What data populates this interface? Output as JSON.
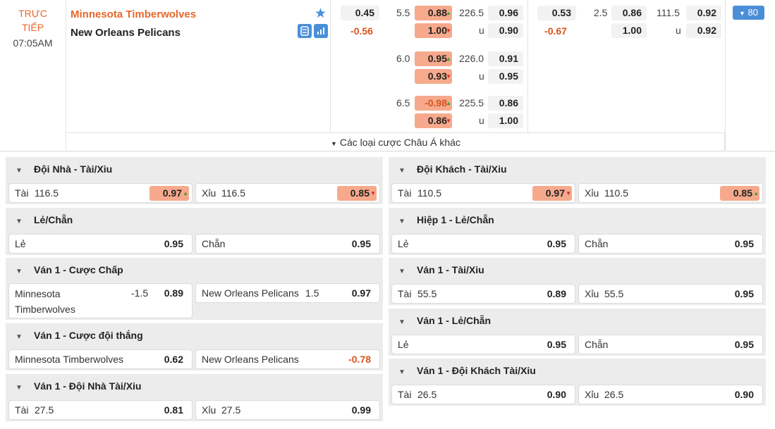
{
  "match": {
    "status": "TRỰC TIẾP",
    "status_line1": "TRỰC",
    "status_line2": "TIẾP",
    "time": "07:05AM",
    "home": "Minnesota Timberwolves",
    "away": "New Orleans Pelicans",
    "more_markets_label": "Các loại cược Châu Á khác",
    "more_count": "80",
    "full_time": {
      "moneyline": {
        "home": "0.45",
        "away": "-0.56"
      },
      "handicap_rows": [
        {
          "line": "5.5",
          "home": "0.88",
          "home_dir": "up",
          "away": "1.00",
          "away_dir": "down",
          "total": "226.5",
          "over": "0.96",
          "under_label": "u",
          "under": "0.90"
        },
        {
          "line": "6.0",
          "home": "0.95",
          "home_dir": "up",
          "away": "0.93",
          "away_dir": "down",
          "total": "226.0",
          "over": "0.91",
          "under_label": "u",
          "under": "0.95"
        },
        {
          "line": "6.5",
          "home": "-0.98",
          "home_dir": "up",
          "away": "0.86",
          "away_dir": "down",
          "total": "225.5",
          "over": "0.86",
          "under_label": "u",
          "under": "1.00"
        }
      ]
    },
    "first_half": {
      "moneyline": {
        "home": "0.53",
        "away": "-0.67"
      },
      "handicap": {
        "line": "2.5",
        "home": "0.86",
        "away": "1.00",
        "total": "111.5",
        "over": "0.92",
        "under_label": "u",
        "under": "0.92"
      }
    }
  },
  "markets_left": [
    {
      "title": "Đội Nhà - Tài/Xiu",
      "options": [
        {
          "label": "Tài",
          "point": "116.5",
          "value": "0.97",
          "dir": "up"
        },
        {
          "label": "Xỉu",
          "point": "116.5",
          "value": "0.85",
          "dir": "down"
        }
      ]
    },
    {
      "title": "Lẻ/Chẵn",
      "options": [
        {
          "label": "Lẻ",
          "point": "",
          "value": "0.95"
        },
        {
          "label": "Chẵn",
          "point": "",
          "value": "0.95"
        }
      ]
    },
    {
      "title": "Ván 1 - Cược Chấp",
      "options": [
        {
          "label": "Minnesota Timberwolves",
          "point": "-1.5",
          "value": "0.89"
        },
        {
          "label": "New Orleans Pelicans",
          "point": "1.5",
          "value": "0.97"
        }
      ]
    },
    {
      "title": "Ván 1 - Cược đội thắng",
      "options": [
        {
          "label": "Minnesota Timberwolves",
          "point": "",
          "value": "0.62"
        },
        {
          "label": "New Orleans Pelicans",
          "point": "",
          "value": "-0.78"
        }
      ]
    },
    {
      "title": "Ván 1 - Đội Nhà Tài/Xiu",
      "options": [
        {
          "label": "Tài",
          "point": "27.5",
          "value": "0.81"
        },
        {
          "label": "Xỉu",
          "point": "27.5",
          "value": "0.99"
        }
      ]
    }
  ],
  "markets_right": [
    {
      "title": "Đội Khách - Tài/Xiu",
      "options": [
        {
          "label": "Tài",
          "point": "110.5",
          "value": "0.97",
          "dir": "down"
        },
        {
          "label": "Xỉu",
          "point": "110.5",
          "value": "0.85",
          "dir": "up"
        }
      ]
    },
    {
      "title": "Hiệp 1 - Lẻ/Chẵn",
      "options": [
        {
          "label": "Lẻ",
          "point": "",
          "value": "0.95"
        },
        {
          "label": "Chẵn",
          "point": "",
          "value": "0.95"
        }
      ]
    },
    {
      "title": "Ván 1 - Tài/Xiu",
      "options": [
        {
          "label": "Tài",
          "point": "55.5",
          "value": "0.89"
        },
        {
          "label": "Xỉu",
          "point": "55.5",
          "value": "0.95"
        }
      ]
    },
    {
      "title": "Ván 1 - Lẻ/Chẵn",
      "options": [
        {
          "label": "Lẻ",
          "point": "",
          "value": "0.95"
        },
        {
          "label": "Chẵn",
          "point": "",
          "value": "0.95"
        }
      ]
    },
    {
      "title": "Ván 1 - Đội Khách Tài/Xiu",
      "options": [
        {
          "label": "Tài",
          "point": "26.5",
          "value": "0.90"
        },
        {
          "label": "Xỉu",
          "point": "26.5",
          "value": "0.90"
        }
      ]
    }
  ],
  "colors": {
    "accent": "#e8672a",
    "blue": "#4a8fd8",
    "highlight": "#f6a98c",
    "up": "#3a9a3a",
    "down": "#d62a2a"
  },
  "icons": [
    "star-icon",
    "lineup-icon",
    "stats-icon",
    "triangle-down-icon",
    "arrow-up-icon",
    "arrow-down-icon",
    "chevron-down-icon"
  ]
}
